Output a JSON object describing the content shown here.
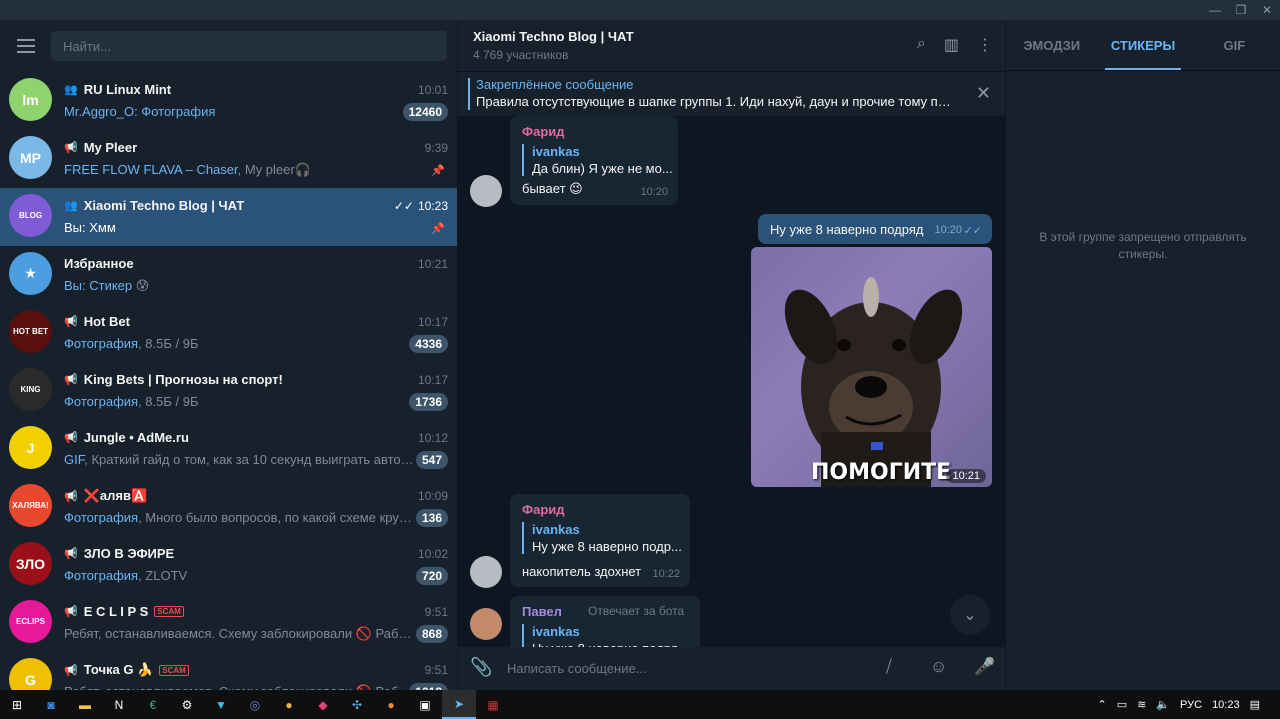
{
  "window": {
    "controls": [
      "—",
      "❐",
      "✕"
    ]
  },
  "search": {
    "placeholder": "Найти..."
  },
  "chats": [
    {
      "name": "RU Linux Mint",
      "type": "group",
      "time": "10:01",
      "preview_hl": "Mr.Aggro_O: Фотография",
      "preview": "",
      "badge": "12460",
      "avatar_color": "#8ed36d",
      "avatar_text": "lm"
    },
    {
      "name": "My Pleer",
      "type": "channel",
      "time": "9:39",
      "preview_hl": "FREE FLOW FLAVA – Chaser",
      "preview": ", My pleer🎧",
      "badge": "",
      "pinned": true,
      "avatar_color": "#7ab8e8",
      "avatar_text": "MP"
    },
    {
      "name": "Xiaomi Techno Blog | ЧАТ",
      "type": "group",
      "time": "10:23",
      "preview_hl": "Вы: Хмм",
      "preview": "",
      "badge": "",
      "pinned": true,
      "active": true,
      "avatar_color": "#7f5cd6",
      "avatar_text": "BLOG"
    },
    {
      "name": "Избранное",
      "type": "saved",
      "time": "10:21",
      "preview_hl": "Вы: Стикер",
      "preview": " 😰",
      "badge": "",
      "avatar_color": "#4d9ee0",
      "avatar_text": "★"
    },
    {
      "name": "Hot Bet",
      "type": "channel",
      "time": "10:17",
      "preview_hl": "Фотография",
      "preview": ", 8.5Б / 9Б",
      "badge": "4336",
      "avatar_color": "#5a0f0f",
      "avatar_text": "HOT BET"
    },
    {
      "name": "King Bets | Прогнозы на спорт!",
      "type": "channel",
      "time": "10:17",
      "preview_hl": "Фотография",
      "preview": ", 8.5Б / 9Б",
      "badge": "1736",
      "avatar_color": "#2a2a2a",
      "avatar_text": "KING"
    },
    {
      "name": "Jungle • AdMe.ru",
      "type": "channel",
      "time": "10:12",
      "preview_hl": "GIF",
      "preview": ", Краткий гайд о том, как за 10 секунд выиграть автомо...",
      "badge": "547",
      "avatar_color": "#f2d000",
      "avatar_text": "J"
    },
    {
      "name": "❌аляв🅰️",
      "type": "channel",
      "time": "10:09",
      "preview_hl": "Фотография",
      "preview": ", Много было вопросов, по какой схеме крути...",
      "badge": "136",
      "avatar_color": "#e8492e",
      "avatar_text": "ХАЛЯВА!"
    },
    {
      "name": "ЗЛО В ЭФИРЕ",
      "type": "channel",
      "time": "10:02",
      "preview_hl": "Фотография",
      "preview": ", ZLOTV",
      "badge": "720",
      "avatar_color": "#9a0f18",
      "avatar_text": "ЗЛО"
    },
    {
      "name": "E C L I P S",
      "type": "channel",
      "time": "9:51",
      "preview_hl": "",
      "preview": "Ребят, останавливаемся. Схему заблокировали 🚫 Работа...",
      "badge": "868",
      "scam": "SCAM",
      "avatar_color": "#e7189a",
      "avatar_text": "ECLIPS"
    },
    {
      "name": "Точка G 🍌",
      "type": "channel",
      "time": "9:51",
      "preview_hl": "",
      "preview": "Ребят, останавливаемся. Схему заблокировали 🚫 Работ...",
      "badge": "1018",
      "scam": "SCAM",
      "avatar_color": "#f0c000",
      "avatar_text": "G"
    }
  ],
  "header": {
    "title": "Xiaomi Techno Blog | ЧАТ",
    "subtitle": "4 769 участников"
  },
  "pinned": {
    "title": "Закреплённое сообщение",
    "text": "Правила отсутствующие в шапке группы 1. Иди нахуй, даун и прочие тому под..."
  },
  "messages": {
    "m1": {
      "sender": "Фарид",
      "sender_color": "#e36aa0",
      "reply_name": "ivankas",
      "reply_text": "Да блин) Я уже не мо...",
      "text": "бывает 😉",
      "time": "10:20"
    },
    "m2": {
      "text": "Ну уже 8 наверно подряд",
      "time": "10:20",
      "ticks": "✓✓"
    },
    "photo": {
      "caption": "ПОМОГИТЕ",
      "time": "10:21"
    },
    "m3": {
      "sender": "Фарид",
      "sender_color": "#e36aa0",
      "reply_name": "ivankas",
      "reply_text": "Ну уже 8 наверно подр...",
      "text": "накопитель здохнет",
      "time": "10:22"
    },
    "m4": {
      "sender": "Павел",
      "sender_color": "#a58ce0",
      "note": "Отвечает за бота",
      "reply_name": "ivankas",
      "reply_text": "Ну уже 8 наверно подря..."
    }
  },
  "compose": {
    "placeholder": "Написать сообщение..."
  },
  "right": {
    "tabs": [
      "ЭМОДЗИ",
      "СТИКЕРЫ",
      "GIF"
    ],
    "note": "В этой группе запрещено отправлять стикеры."
  },
  "taskbar": {
    "lang": "РУС",
    "time": "10:23"
  }
}
